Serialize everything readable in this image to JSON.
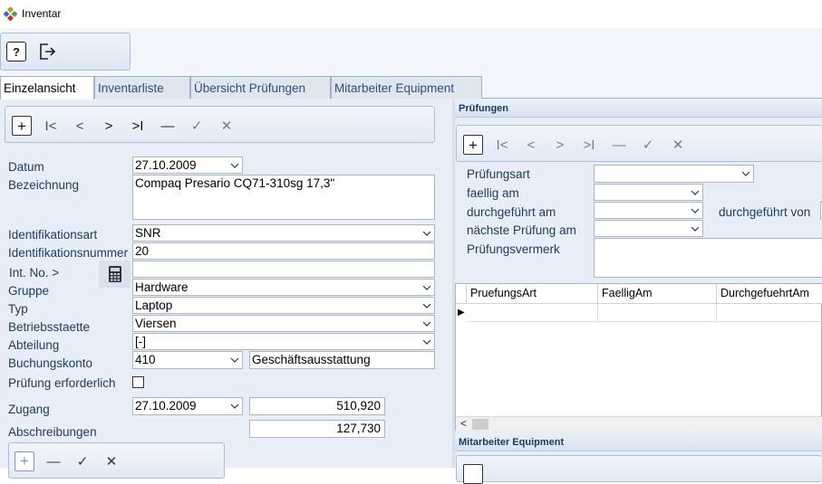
{
  "window": {
    "title": "Inventar"
  },
  "toolbar": {
    "help_label": "?"
  },
  "tabs": [
    {
      "label": "Einzelansicht",
      "active": true
    },
    {
      "label": "Inventarliste",
      "active": false
    },
    {
      "label": "Übersicht Prüfungen",
      "active": false
    },
    {
      "label": "Mitarbeiter Equipment",
      "active": false
    }
  ],
  "navigator": {
    "buttons": [
      "add",
      "first",
      "previous",
      "next",
      "last",
      "delete",
      "save",
      "cancel"
    ]
  },
  "form": {
    "datum": {
      "label": "Datum",
      "value": "27.10.2009"
    },
    "bezeichnung": {
      "label": "Bezeichnung",
      "value": "Compaq Presario CQ71-310sg 17,3\""
    },
    "identifikationsart": {
      "label": "Identifikationsart",
      "value": "SNR"
    },
    "identifikationsnummer": {
      "label": "Identifikationsnummer",
      "value": "20"
    },
    "int_no": {
      "label": "Int. No. >",
      "value": ""
    },
    "gruppe": {
      "label": "Gruppe",
      "value": "Hardware"
    },
    "typ": {
      "label": "Typ",
      "value": "Laptop"
    },
    "betriebsstaette": {
      "label": "Betriebsstaette",
      "value": "Viersen"
    },
    "abteilung": {
      "label": "Abteilung",
      "value": "[-]"
    },
    "buchungskonto": {
      "label": "Buchungskonto",
      "value": "410",
      "description": "Geschäftsausstattung"
    },
    "pruefung_erforderlich": {
      "label": "Prüfung erforderlich",
      "checked": false
    },
    "zugang": {
      "label": "Zugang",
      "date": "27.10.2009",
      "amount": "510,920"
    },
    "abschreibungen": {
      "label": "Abschreibungen",
      "amount": "127,730"
    }
  },
  "pruefungen": {
    "header": "Prüfungen",
    "pruefungsart": {
      "label": "Prüfungsart",
      "value": ""
    },
    "faellig_am": {
      "label": "faellig am",
      "value": ""
    },
    "durchgefuehrt_am": {
      "label": "durchgeführt am",
      "value": ""
    },
    "durchgefuehrt_von": {
      "label": "durchgeführt von",
      "value": ""
    },
    "naechste_pruefung": {
      "label": "nächste Prüfung am",
      "value": ""
    },
    "pruefungsvermerk": {
      "label": "Prüfungsvermerk",
      "value": ""
    },
    "grid": {
      "columns": [
        "PruefungsArt",
        "FaelligAm",
        "DurchgefuehrtAm"
      ],
      "row_indicator": "▶",
      "scroll_left": "<"
    }
  },
  "mitarbeiter": {
    "header": "Mitarbeiter Equipment"
  },
  "colors": {
    "panel": "#e7eef7",
    "tab_border": "#9fb4cc",
    "label_text": "#1e395b"
  }
}
